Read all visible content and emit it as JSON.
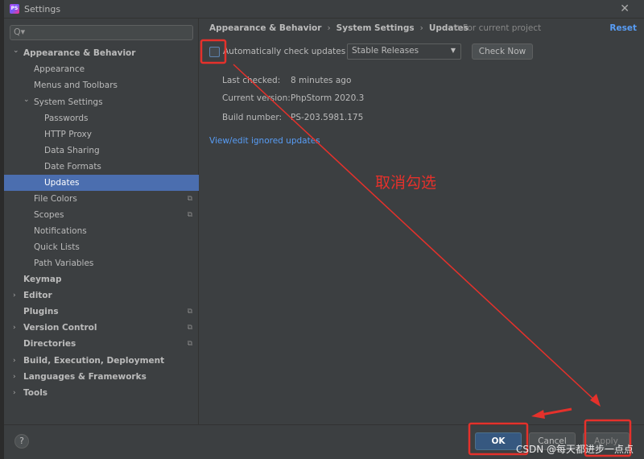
{
  "window": {
    "title": "Settings",
    "close_icon": "close-icon"
  },
  "sidebar": {
    "search_placeholder": "Q▾",
    "items": [
      {
        "label": "Appearance & Behavior",
        "level": 0,
        "bold": true,
        "chevron": "down"
      },
      {
        "label": "Appearance",
        "level": 1
      },
      {
        "label": "Menus and Toolbars",
        "level": 1
      },
      {
        "label": "System Settings",
        "level": 1,
        "chevron": "down"
      },
      {
        "label": "Passwords",
        "level": 2
      },
      {
        "label": "HTTP Proxy",
        "level": 2
      },
      {
        "label": "Data Sharing",
        "level": 2
      },
      {
        "label": "Date Formats",
        "level": 2
      },
      {
        "label": "Updates",
        "level": 2,
        "selected": true
      },
      {
        "label": "File Colors",
        "level": 1,
        "project": true
      },
      {
        "label": "Scopes",
        "level": 1,
        "project": true
      },
      {
        "label": "Notifications",
        "level": 1
      },
      {
        "label": "Quick Lists",
        "level": 1
      },
      {
        "label": "Path Variables",
        "level": 1
      },
      {
        "label": "Keymap",
        "level": 0,
        "bold": true
      },
      {
        "label": "Editor",
        "level": 0,
        "bold": true,
        "chevron": "right"
      },
      {
        "label": "Plugins",
        "level": 0,
        "bold": true,
        "project": true
      },
      {
        "label": "Version Control",
        "level": 0,
        "bold": true,
        "chevron": "right",
        "project": true
      },
      {
        "label": "Directories",
        "level": 0,
        "bold": true,
        "project": true
      },
      {
        "label": "Build, Execution, Deployment",
        "level": 0,
        "bold": true,
        "chevron": "right"
      },
      {
        "label": "Languages & Frameworks",
        "level": 0,
        "bold": true,
        "chevron": "right"
      },
      {
        "label": "Tools",
        "level": 0,
        "bold": true,
        "chevron": "right"
      }
    ]
  },
  "main": {
    "breadcrumb": [
      "Appearance & Behavior",
      "System Settings",
      "Updates"
    ],
    "for_project": "For current project",
    "reset": "Reset",
    "auto_check_label": "Automatically check updates for",
    "auto_check_checked": false,
    "channel": "Stable Releases",
    "check_now": "Check Now",
    "info": [
      {
        "label": "Last checked:",
        "value": "8 minutes ago"
      },
      {
        "label": "Current version:",
        "value": "PhpStorm 2020.3"
      },
      {
        "label": "Build number:",
        "value": "PS-203.5981.175"
      }
    ],
    "ignored_link": "View/edit ignored updates"
  },
  "footer": {
    "help": "?",
    "ok": "OK",
    "cancel": "Cancel",
    "apply": "Apply"
  },
  "annotation": {
    "text": "取消勾选",
    "color": "#e5312b"
  },
  "watermark": "CSDN @每天都进步一点点"
}
